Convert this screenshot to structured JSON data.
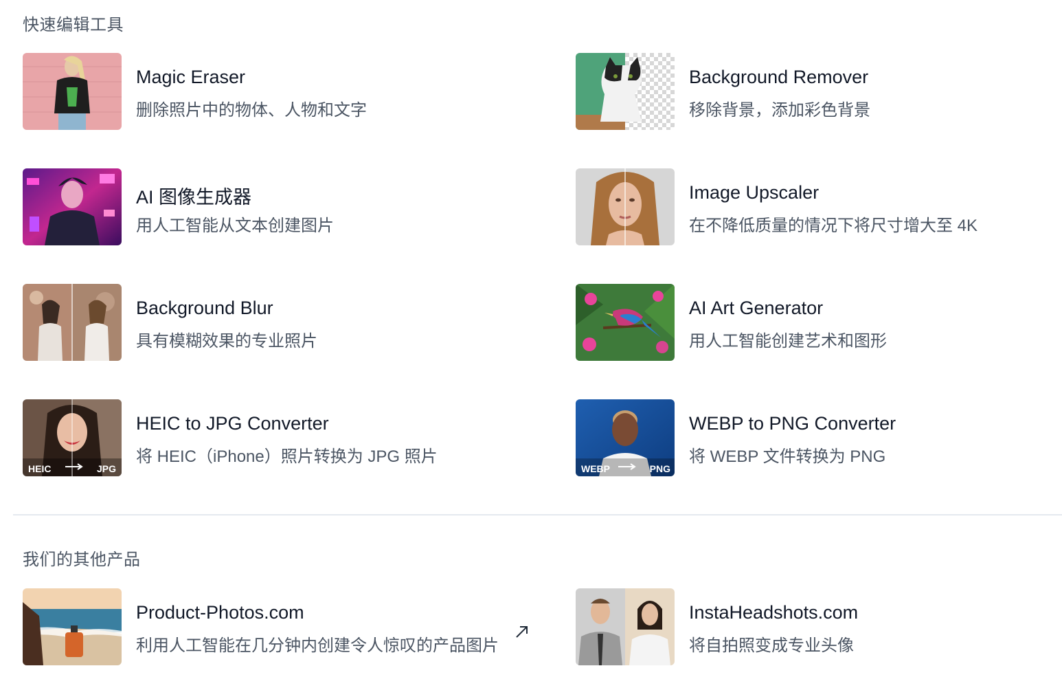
{
  "sections": {
    "quick_tools_title": "快速编辑工具",
    "other_products_title": "我们的其他产品"
  },
  "tools": [
    {
      "title": "Magic Eraser",
      "desc": "删除照片中的物体、人物和文字"
    },
    {
      "title": "Background Remover",
      "desc": "移除背景，添加彩色背景"
    },
    {
      "title": "AI 图像生成器",
      "desc": "用人工智能从文本创建图片"
    },
    {
      "title": "Image Upscaler",
      "desc": "在不降低质量的情况下将尺寸增大至 4K"
    },
    {
      "title": "Background Blur",
      "desc": "具有模糊效果的专业照片"
    },
    {
      "title": "AI Art Generator",
      "desc": "用人工智能创建艺术和图形"
    },
    {
      "title": "HEIC to JPG Converter",
      "desc": "将 HEIC（iPhone）照片转换为 JPG 照片",
      "from": "HEIC",
      "to": "JPG"
    },
    {
      "title": "WEBP to PNG Converter",
      "desc": "将 WEBP 文件转换为 PNG",
      "from": "WEBP",
      "to": "PNG"
    }
  ],
  "products": [
    {
      "title": "Product-Photos.com",
      "desc": "利用人工智能在几分钟内创建令人惊叹的产品图片",
      "icon": "external-link-icon"
    },
    {
      "title": "InstaHeadshots.com",
      "desc": "将自拍照变成专业头像"
    }
  ],
  "colors": {
    "heading": "#4b5563",
    "title": "#111827",
    "description": "#4b5563",
    "divider": "#e5e9ef"
  }
}
